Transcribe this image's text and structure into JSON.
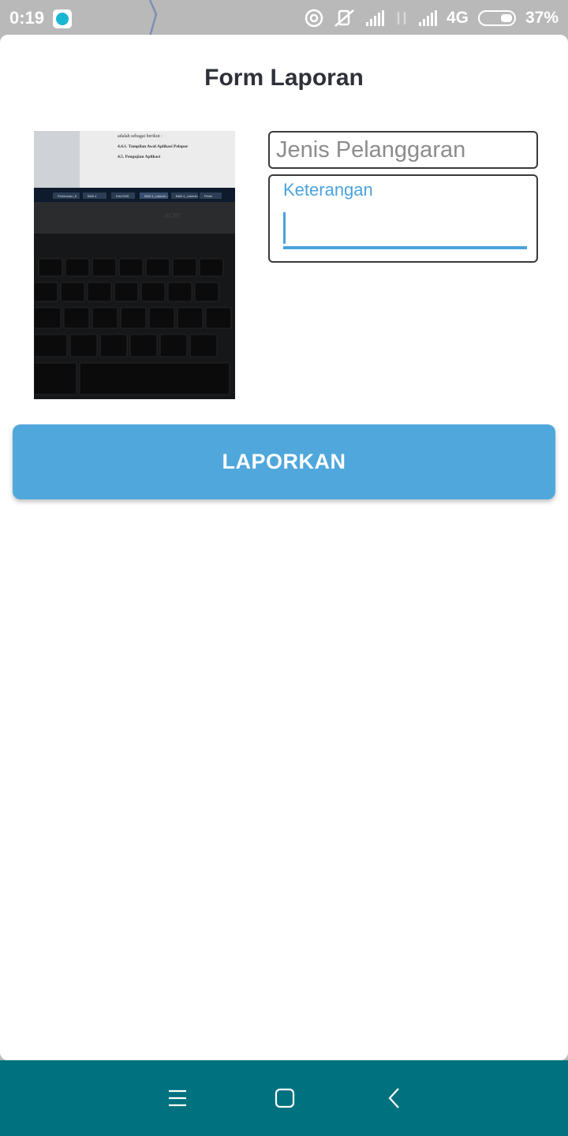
{
  "status_bar": {
    "time": "0:19",
    "network": "4G",
    "battery": "37%",
    "icons": [
      "app-notification-icon",
      "hotspot-icon",
      "mute-icon",
      "signal-icon",
      "data-arrows-icon",
      "signal-icon",
      "battery-icon"
    ]
  },
  "form": {
    "title": "Form Laporan",
    "jenis_placeholder": "Jenis Pelanggaran",
    "keterangan_label": "Keterangan",
    "submit_label": "LAPORKAN"
  },
  "photo": {
    "doc_lines": [
      "adalah sebagai berikut :",
      "4.4.1.   Tampilan Awal Aplikasi Pelapor",
      "4.5.     Pengujian Aplikasi"
    ],
    "brand": "acer",
    "taskbar_items": [
      "Pertemuan_6",
      "BAB 4",
      "Dist.DNS",
      "BAB 4_Lakenin...",
      "BAB 4_Lakenin...",
      "Pinter"
    ]
  },
  "nav_bar": {
    "icons": [
      "menu-icon",
      "home-icon",
      "back-icon"
    ]
  },
  "colors": {
    "accent": "#4fa7dc",
    "navbar": "#00717f",
    "statusbar": "#b9b9b9"
  }
}
